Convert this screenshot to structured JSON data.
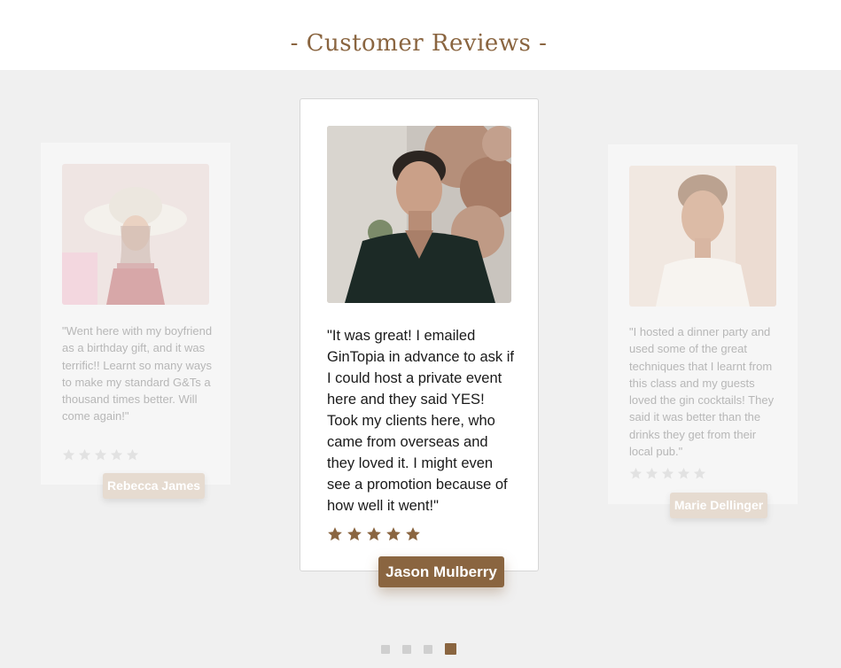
{
  "section": {
    "title": "- Customer Reviews -"
  },
  "colors": {
    "accent": "#8a6540",
    "star_active": "#8a6540",
    "star_faded": "#e2e2e2"
  },
  "reviews": [
    {
      "name": "Rebecca James",
      "quote": "\"Went here with my boyfriend as a birthday gift, and it was terrific!! Learnt so many ways to make my standard G&Ts a thousand times better. Will come again!\"",
      "rating": 5,
      "photo_icon": "woman-with-sunhat-photo"
    },
    {
      "name": "Jason Mulberry",
      "quote": "\"It was great! I emailed GinTopia in advance to ask if I could host a private event here and they said YES! Took my clients here, who came from overseas and they loved it. I might even see a promotion because of how well it went!\"",
      "rating": 5,
      "photo_icon": "man-in-dark-shirt-photo"
    },
    {
      "name": "Marie Dellinger",
      "quote": "\"I hosted a dinner party and used some of the great techniques that I learnt from this class and my guests loved the gin cocktails! They said it was better than the drinks they get from their local pub.\"",
      "rating": 5,
      "photo_icon": "smiling-woman-photo"
    }
  ],
  "pagination": {
    "count": 4,
    "active_index": 3
  }
}
